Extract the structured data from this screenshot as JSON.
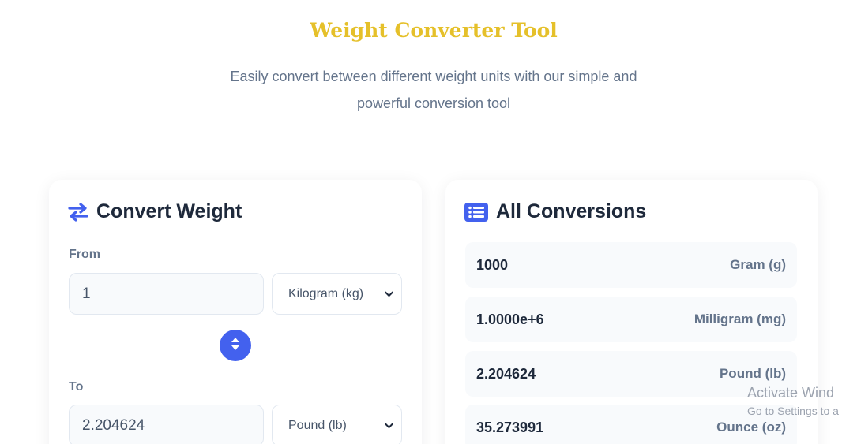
{
  "header": {
    "title": "Weight Converter Tool",
    "subtitle_line1": "Easily convert between different weight units with our simple and",
    "subtitle_line2": "powerful conversion tool"
  },
  "converter": {
    "title": "Convert Weight",
    "icon": "swap-arrows-icon",
    "from_label": "From",
    "from_value": "1",
    "from_unit": "Kilogram (kg)",
    "to_label": "To",
    "to_value": "2.204624",
    "to_unit": "Pound (lb)"
  },
  "conversions": {
    "title": "All Conversions",
    "icon": "list-icon",
    "rows": [
      {
        "value": "1000",
        "unit": "Gram (g)"
      },
      {
        "value": "1.0000e+6",
        "unit": "Milligram (mg)"
      },
      {
        "value": "2.204624",
        "unit": "Pound (lb)"
      },
      {
        "value": "35.273991",
        "unit": "Ounce (oz)"
      }
    ]
  },
  "watermark": {
    "line1": "Activate Wind",
    "line2": "Go to Settings to a"
  },
  "colors": {
    "accent": "#4361ee",
    "title": "#e5c02a"
  }
}
